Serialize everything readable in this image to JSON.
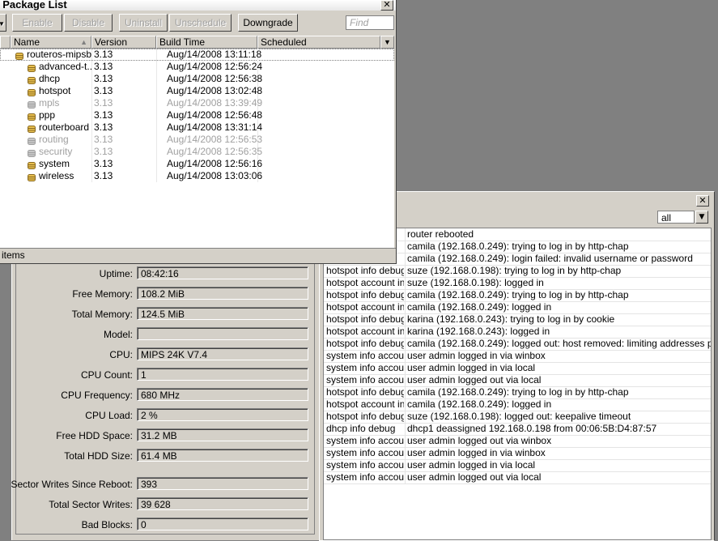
{
  "package_window": {
    "title": "l Package List",
    "find_placeholder": "Find",
    "toolbar": {
      "enable": "Enable",
      "disable": "Disable",
      "uninstall": "Uninstall",
      "unschedule": "Unschedule",
      "downgrade": "Downgrade"
    },
    "columns": {
      "name": "Name",
      "version": "Version",
      "build_time": "Build Time",
      "scheduled": "Scheduled"
    },
    "packages": [
      {
        "name": "routeros-mipsbe",
        "version": "3.13",
        "build_time": "Aug/14/2008 13:11:18",
        "scheduled": "",
        "disabled": false,
        "child": false
      },
      {
        "name": "advanced-t...",
        "version": "3.13",
        "build_time": "Aug/14/2008 12:56:24",
        "scheduled": "",
        "disabled": false,
        "child": true
      },
      {
        "name": "dhcp",
        "version": "3.13",
        "build_time": "Aug/14/2008 12:56:38",
        "scheduled": "",
        "disabled": false,
        "child": true
      },
      {
        "name": "hotspot",
        "version": "3.13",
        "build_time": "Aug/14/2008 13:02:48",
        "scheduled": "",
        "disabled": false,
        "child": true
      },
      {
        "name": "mpls",
        "version": "3.13",
        "build_time": "Aug/14/2008 13:39:49",
        "scheduled": "",
        "disabled": true,
        "child": true
      },
      {
        "name": "ppp",
        "version": "3.13",
        "build_time": "Aug/14/2008 12:56:48",
        "scheduled": "",
        "disabled": false,
        "child": true
      },
      {
        "name": "routerboard",
        "version": "3.13",
        "build_time": "Aug/14/2008 13:31:14",
        "scheduled": "",
        "disabled": false,
        "child": true
      },
      {
        "name": "routing",
        "version": "3.13",
        "build_time": "Aug/14/2008 12:56:53",
        "scheduled": "",
        "disabled": true,
        "child": true
      },
      {
        "name": "security",
        "version": "3.13",
        "build_time": "Aug/14/2008 12:56:35",
        "scheduled": "",
        "disabled": true,
        "child": true
      },
      {
        "name": "system",
        "version": "3.13",
        "build_time": "Aug/14/2008 12:56:16",
        "scheduled": "",
        "disabled": false,
        "child": true
      },
      {
        "name": "wireless",
        "version": "3.13",
        "build_time": "Aug/14/2008 13:03:06",
        "scheduled": "",
        "disabled": false,
        "child": true
      }
    ],
    "status_text": "items"
  },
  "resources": [
    {
      "label": "Uptime:",
      "value": "08:42:16"
    },
    {
      "label": "Free Memory:",
      "value": "108.2 MiB"
    },
    {
      "label": "Total Memory:",
      "value": "124.5 MiB"
    },
    {
      "label": "Model:",
      "value": ""
    },
    {
      "label": "CPU:",
      "value": "MIPS 24K V7.4"
    },
    {
      "label": "CPU Count:",
      "value": "1"
    },
    {
      "label": "CPU Frequency:",
      "value": "680 MHz"
    },
    {
      "label": "CPU Load:",
      "value": "2 %"
    },
    {
      "label": "Free HDD Space:",
      "value": "31.2 MB"
    },
    {
      "label": "Total HDD Size:",
      "value": "61.4 MB"
    },
    {
      "label": "Sector Writes Since Reboot:",
      "value": "393"
    },
    {
      "label": "Total Sector Writes:",
      "value": "39 628"
    },
    {
      "label": "Bad Blocks:",
      "value": "0"
    }
  ],
  "log_window": {
    "filter_value": "all",
    "entries": [
      {
        "topics": "",
        "message": "router rebooted"
      },
      {
        "topics": "",
        "message": "camila (192.168.0.249): trying to log in by http-chap"
      },
      {
        "topics": "",
        "message": "camila (192.168.0.249): login failed: invalid username or password"
      },
      {
        "topics": "hotspot info debug",
        "message": "suze (192.168.0.198): trying to log in by http-chap"
      },
      {
        "topics": "hotspot account in...",
        "message": "suze (192.168.0.198): logged in"
      },
      {
        "topics": "hotspot info debug",
        "message": "camila (192.168.0.249): trying to log in by http-chap"
      },
      {
        "topics": "hotspot account in...",
        "message": "camila (192.168.0.249): logged in"
      },
      {
        "topics": "hotspot info debug",
        "message": "karina (192.168.0.243): trying to log in by cookie"
      },
      {
        "topics": "hotspot account in...",
        "message": "karina (192.168.0.243): logged in"
      },
      {
        "topics": "hotspot info debug",
        "message": "camila (192.168.0.249): logged out: host removed: limiting addresses per mac"
      },
      {
        "topics": "system info account",
        "message": "user admin logged in via winbox"
      },
      {
        "topics": "system info account",
        "message": "user admin logged in via local"
      },
      {
        "topics": "system info account",
        "message": "user admin logged out via local"
      },
      {
        "topics": "hotspot info debug",
        "message": "camila (192.168.0.249): trying to log in by http-chap"
      },
      {
        "topics": "hotspot account in...",
        "message": "camila (192.168.0.249): logged in"
      },
      {
        "topics": "hotspot info debug",
        "message": "suze (192.168.0.198): logged out: keepalive timeout"
      },
      {
        "topics": "dhcp info debug",
        "message": "dhcp1 deassigned 192.168.0.198 from 00:06:5B:D4:87:57"
      },
      {
        "topics": "system info account",
        "message": "user admin logged out via winbox"
      },
      {
        "topics": "system info account",
        "message": "user admin logged in via winbox"
      },
      {
        "topics": "system info account",
        "message": "user admin logged in via local"
      },
      {
        "topics": "system info account",
        "message": "user admin logged out via local"
      }
    ]
  }
}
